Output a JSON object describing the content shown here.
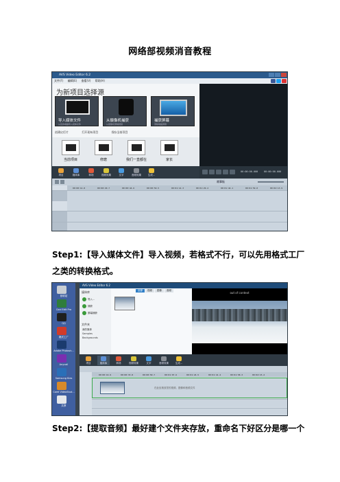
{
  "document": {
    "title": "网络部视频消音教程",
    "step1": "Step1:【导入媒体文件】导入视频，若格式不行，可以先用格式工厂之类的转换格式。",
    "step2": "Step2:【提取音频】最好建个文件夹存放，重命名下好区分是哪一个"
  },
  "screenshot1": {
    "window_title": "AVS Video Editor 6.2",
    "menu": [
      "文件(F)",
      "编辑(E)",
      "查看(V)",
      "帮助(H)"
    ],
    "heading": "为新项目选择源",
    "tiles": [
      {
        "label": "导入媒体文件",
        "sub": "从您的电脑导入媒体文件"
      },
      {
        "label": "从摄像机捕获",
        "sub": "从摄像机录制视频"
      },
      {
        "label": "捕获屏幕",
        "sub": "录制电脑屏幕"
      }
    ],
    "options": [
      "创建幻灯片",
      "打开现有项目",
      "保存当前项目"
    ],
    "recent": [
      "当前项目",
      "修磨",
      "我们一直都在",
      "家长"
    ],
    "toolbar": [
      "项目",
      "媒体库",
      "转场",
      "视频效果",
      "文字",
      "音频效果",
      "生成..."
    ],
    "time_left": "00:00:00.000",
    "time_right": "00:00:00.000",
    "zoom_label": "故事板",
    "ruler": [
      "00:00:14.8",
      "00:00:29.7",
      "00:00:44.6",
      "00:00:59.5",
      "00:01:14.3",
      "00:01:29.2",
      "00:01:44.1",
      "00:01:59.0",
      "00:02:13.9"
    ]
  },
  "screenshot2": {
    "window_title": "AVS Video Editor 6.2",
    "desktop_icons": [
      "回收站",
      "Cool Edit Pro",
      "QQ",
      "格式工厂",
      "Adobe Photosh...",
      "Anycall",
      "Samsung Kies",
      "Corel VideoStud...",
      "共享"
    ],
    "library_heading": "媒体库",
    "library_buttons": [
      "导入...",
      "捕获",
      "屏幕捕获"
    ],
    "folders_heading": "文件夹",
    "folders": [
      "我的媒体",
      "Samples",
      "Backgrounds"
    ],
    "tabs": [
      "全部",
      "视频",
      "图像",
      "音频"
    ],
    "preview_label": "out of context",
    "toolbar": [
      "项目",
      "媒体库",
      "转场",
      "视频效果",
      "文字",
      "音频效果",
      "生成..."
    ],
    "ruler": [
      "00:00:16.9",
      "00:00:33.8",
      "00:00:50.7",
      "00:01:07.6",
      "00:01:24.5",
      "00:01:41.4",
      "00:01:58.3",
      "00:02:15.2"
    ],
    "track_hint": "在此处拖放您的视频、图像和音频文件"
  },
  "colors": {
    "accent_blue": "#2f7fc7",
    "track_green": "#3aa84a"
  }
}
